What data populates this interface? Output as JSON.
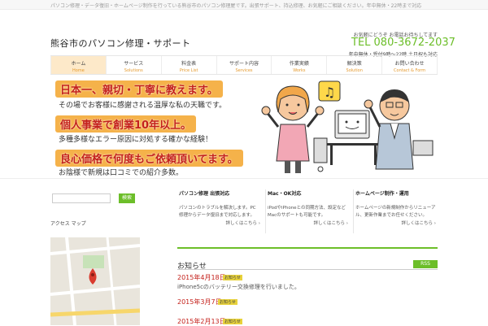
{
  "topbar": {
    "text": "パソコン修理・データ復旧・ホームページ制作を行っている熊谷市のパソコン修理屋です。出張サポート、持込修理、お気軽にご相談ください。年中無休・22時まで対応"
  },
  "header": {
    "site_title": "熊谷市のパソコン修理・サポート",
    "tel_small": "お気軽にどうぞ お電話お待ちしてます",
    "tel": "TEL 080-3672-2037",
    "tel_note": "年中無休・受付9時〜22時 土日祝も対応"
  },
  "nav": [
    {
      "label": "ホーム",
      "sub": "Home",
      "active": true
    },
    {
      "label": "サービス",
      "sub": "Solutions",
      "active": false
    },
    {
      "label": "料金表",
      "sub": "Price List",
      "active": false
    },
    {
      "label": "サポート内容",
      "sub": "Services",
      "active": false
    },
    {
      "label": "作業実績",
      "sub": "Works",
      "active": false
    },
    {
      "label": "解決策",
      "sub": "Solution",
      "active": false
    },
    {
      "label": "お問い合わせ",
      "sub": "Contact & Form",
      "active": false
    }
  ],
  "banner": {
    "h1": "日本一、親切・丁寧に教えます。",
    "t1": "その場でお客様に感謝される温厚な私の天職です。",
    "h2": "個人事業で創業10年以上。",
    "t2": "多種多様なエラー原因に対処する確かな経験！",
    "h3": "良心価格で何度もご依頼頂いてます。",
    "t3": "お陰様で新規は口コミでの紹介多数。"
  },
  "search": {
    "placeholder": "",
    "button": "検索"
  },
  "sidebar": {
    "heading": "アクセス マップ"
  },
  "columns": [
    {
      "title": "パソコン修理 出張対応",
      "body": "パソコンのトラブルを解決します。PC修理からデータ復旧まで対応します。",
      "more": "詳しくはこちら ›"
    },
    {
      "title": "Mac・OK対応",
      "body": "iPodやiPhoneとの同期方法、設定などMacのサポートも可能です。",
      "more": "詳しくはこちら ›"
    },
    {
      "title": "ホームページ制作・運用",
      "body": "ホームページの新規制作からリニューアル、更新作業までお任せください。",
      "more": "詳しくはこちら ›"
    }
  ],
  "info": {
    "title": "お知らせ",
    "rss": "RSS"
  },
  "posts": [
    {
      "date": "2015年4月18日",
      "tag": "お知らせ",
      "title": "iPhone5cのバッテリー交換修理を行いました。"
    },
    {
      "date": "2015年3月7日",
      "tag": "お知らせ"
    },
    {
      "date": "2015年2月13日",
      "tag": "お知らせ"
    }
  ],
  "colors": {
    "accent": "#6cbe29",
    "banner_bar": "#f5b24a",
    "banner_text": "#c4211b"
  }
}
